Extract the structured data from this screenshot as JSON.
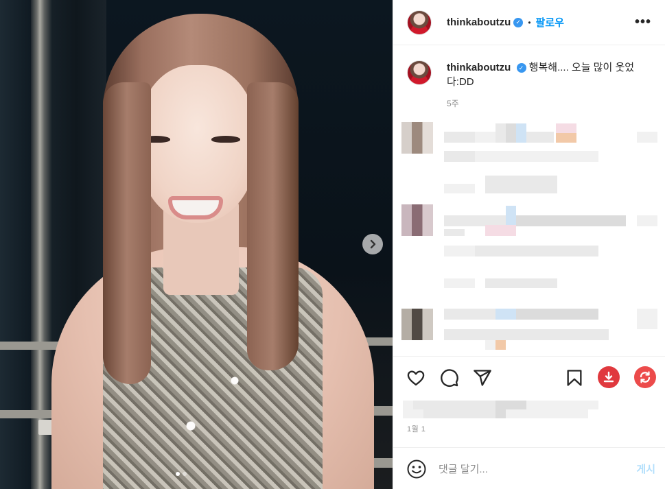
{
  "post": {
    "username": "thinkaboutzu",
    "verified_icon": "verified-badge-icon",
    "separator": "•",
    "follow_label": "팔로우",
    "more_label": "•••",
    "caption_text": "행복해.... 오늘 많이 웃었다:DD",
    "caption_time": "5주",
    "post_time": "1월 1",
    "carousel": {
      "slide_count": 2,
      "active_slide": 1
    }
  },
  "composer": {
    "placeholder": "댓글 달기...",
    "post_label": "게시"
  },
  "icons": {
    "like": "heart-icon",
    "comment": "comment-bubble-icon",
    "share": "paper-plane-icon",
    "save": "bookmark-icon",
    "download": "download-icon",
    "repost": "repost-icon",
    "emoji": "smiley-icon",
    "next": "chevron-right-icon"
  },
  "colors": {
    "accent": "#0095f6",
    "verified": "#3897f0",
    "download_button": "#e0393e",
    "repost_button": "#ec4b4b",
    "post_disabled": "#b2dffc"
  }
}
